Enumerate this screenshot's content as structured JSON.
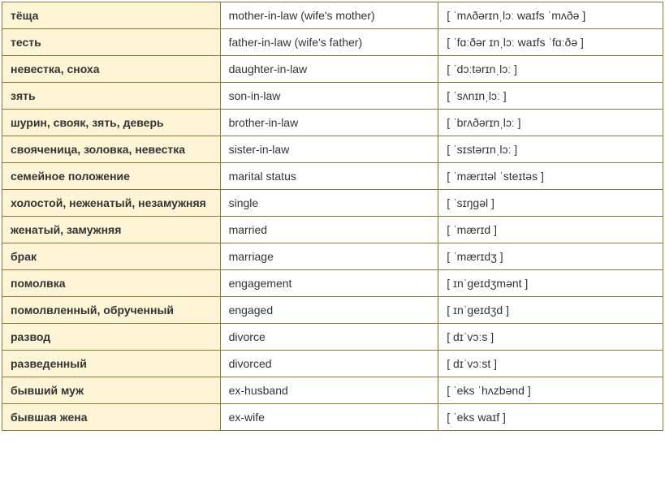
{
  "rows": [
    {
      "russian": "тёща",
      "english": "mother-in-law (wife's mother)",
      "phonetic": "[ ˈmʌðərɪnˌlɔː waɪfs ˈmʌðə ]"
    },
    {
      "russian": "тесть",
      "english": "father-in-law (wife's father)",
      "phonetic": "[ ˈfɑːðər ɪnˌlɔː waɪfs ˈfɑːðə ]"
    },
    {
      "russian": "невестка, сноха",
      "english": "daughter-in-law",
      "phonetic": "[ ˈdɔːtərɪnˌlɔː ]"
    },
    {
      "russian": "зять",
      "english": "son-in-law",
      "phonetic": "[ ˈsʌnɪnˌlɔː ]"
    },
    {
      "russian": "шурин, свояк, зять, деверь",
      "english": "brother-in-law",
      "phonetic": "[ ˈbrʌðərɪnˌlɔː ]"
    },
    {
      "russian": "свояченица, золовка, невестка",
      "english": "sister-in-law",
      "phonetic": "[ ˈsɪstərɪnˌlɔː ]"
    },
    {
      "russian": "семейное положение",
      "english": "marital status",
      "phonetic": "[ ˈmærɪtəl ˈsteɪtəs ]"
    },
    {
      "russian": "холостой, неженатый, незамужняя",
      "english": "single",
      "phonetic": "[ ˈsɪŋgəl ]"
    },
    {
      "russian": "женатый, замужняя",
      "english": "married",
      "phonetic": "[ ˈmærɪd ]"
    },
    {
      "russian": "брак",
      "english": "marriage",
      "phonetic": "[ ˈmærɪdʒ ]"
    },
    {
      "russian": "помолвка",
      "english": "engagement",
      "phonetic": "[ ɪnˈgeɪdʒmənt ]"
    },
    {
      "russian": "помолвленный, обрученный",
      "english": "engaged",
      "phonetic": "[ ɪnˈgeɪdʒd ]"
    },
    {
      "russian": "развод",
      "english": "divorce",
      "phonetic": "[ dɪˈvɔːs ]"
    },
    {
      "russian": "разведенный",
      "english": "divorced",
      "phonetic": "[ dɪˈvɔːst ]"
    },
    {
      "russian": "бывший муж",
      "english": "ex-husband",
      "phonetic": "[ ˈeks ˈhʌzbənd ]"
    },
    {
      "russian": "бывшая жена",
      "english": "ex-wife",
      "phonetic": "[ ˈeks waɪf ]"
    }
  ]
}
